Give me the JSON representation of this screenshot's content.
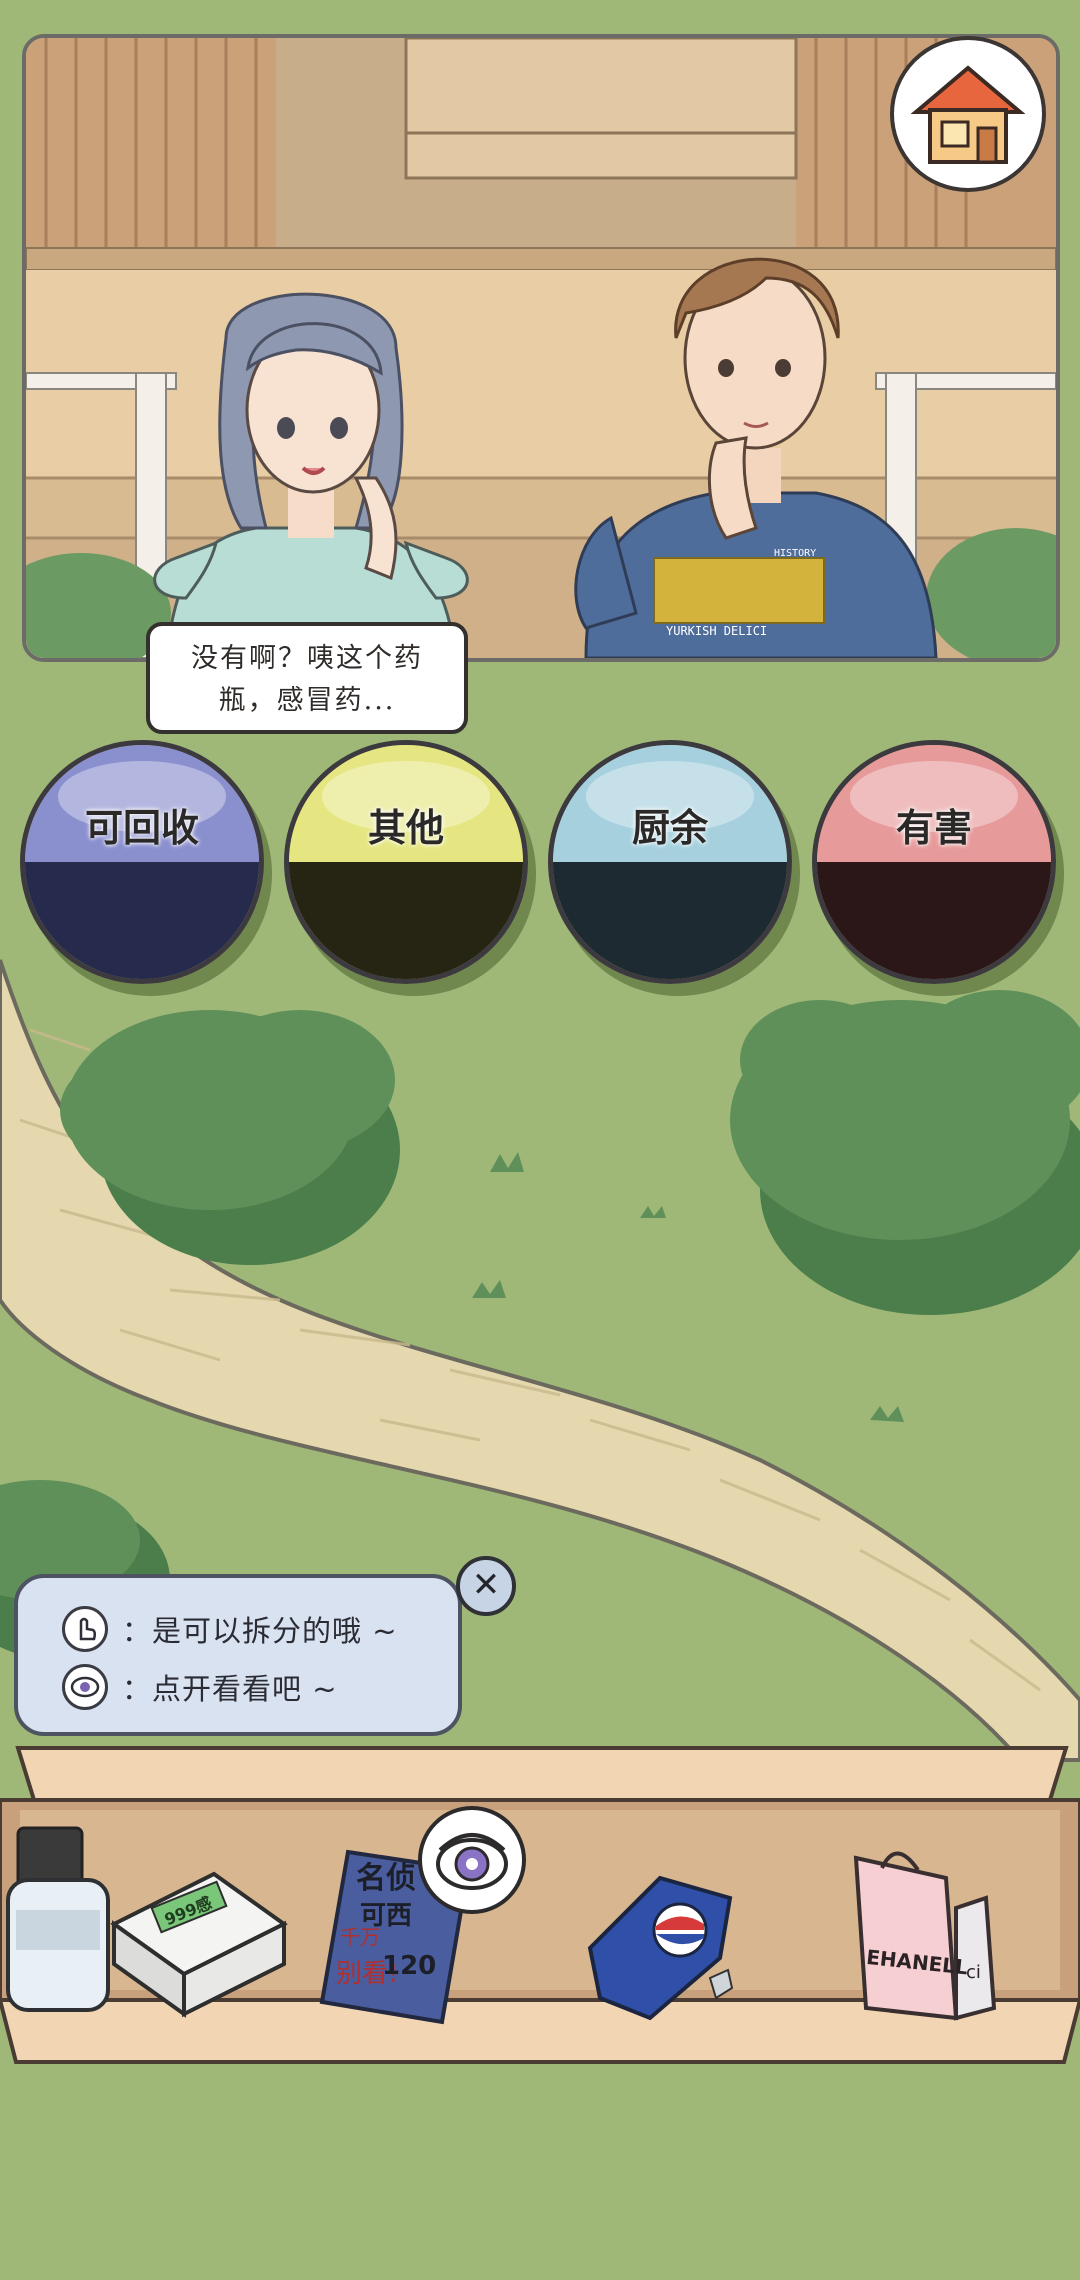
{
  "dialogue": {
    "line1": "没有啊？咦这个药",
    "line2": "瓶，感冒药..."
  },
  "bins": [
    {
      "label": "可回收",
      "top_color": "#8a8fce",
      "bottom_color": "#262b4e",
      "ring_color": "#6f74bd"
    },
    {
      "label": "其他",
      "top_color": "#e5e681",
      "bottom_color": "#262514",
      "ring_color": "#cfd064"
    },
    {
      "label": "厨余",
      "top_color": "#a6d0de",
      "bottom_color": "#1e2a31",
      "ring_color": "#8dbccc"
    },
    {
      "label": "有害",
      "top_color": "#e69a9a",
      "bottom_color": "#2c1718",
      "ring_color": "#d17d7d"
    }
  ],
  "hint": {
    "tap_text": "：是可以拆分的哦 ~",
    "eye_text": "：点开看看吧 ~"
  },
  "close_button": {
    "symbol": "✕"
  },
  "shirt_text": {
    "brand": "YURKISH DELICI",
    "small": "HISTORY"
  },
  "items": {
    "box_label": "999感",
    "book_lines": [
      "名侦",
      "可西",
      "千万",
      "别看!",
      "120"
    ],
    "bag_label": "EHANELL",
    "bag_side": "ci"
  },
  "colors": {
    "grass": "#9fb877",
    "path": "#e6d9b1",
    "bush_dark": "#4b7e4b",
    "bush": "#5f905a"
  }
}
